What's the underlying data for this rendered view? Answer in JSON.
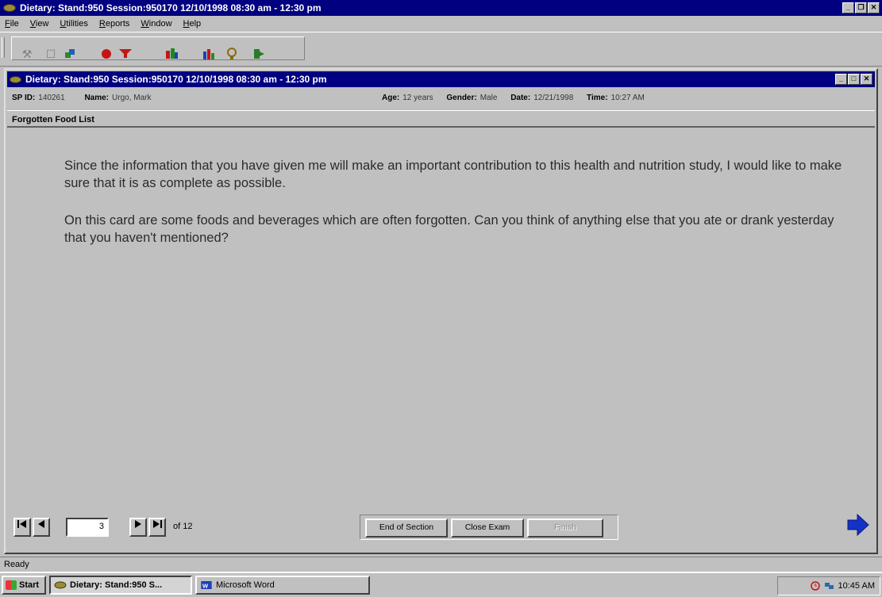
{
  "window": {
    "title": "Dietary: Stand:950 Session:950170 12/10/1998 08:30 am - 12:30 pm"
  },
  "menu": [
    "File",
    "View",
    "Utilities",
    "Reports",
    "Window",
    "Help"
  ],
  "toolbar": {
    "icons": [
      "tool-icon",
      "new-document-icon",
      "flag-icon",
      "record-icon",
      "funnel-icon",
      "chart-icon",
      "stats-icon",
      "bulb-icon",
      "exit-icon"
    ]
  },
  "child_window": {
    "title": "Dietary: Stand:950 Session:950170 12/10/1998 08:30 am - 12:30 pm"
  },
  "info": {
    "sp_label": "SP ID:",
    "sp_value": "140261",
    "name_label": "Name:",
    "name_value": "Urgo, Mark",
    "age_label": "Age:",
    "age_value": "12 years",
    "gender_label": "Gender:",
    "gender_value": "Male",
    "date_label": "Date:",
    "date_value": "12/21/1998",
    "time_label": "Time:",
    "time_value": "10:27 AM"
  },
  "section": {
    "title": "Forgotten Food List"
  },
  "content": {
    "para1": "Since the information that you have given me will make an important contribution to this health and nutrition study, I would like to make sure that it is as complete as possible.",
    "para2": "On this card are some foods and beverages which are often forgotten. Can you think of anything else that you ate or drank yesterday that you haven't mentioned?"
  },
  "navigation": {
    "current_page": "3",
    "of_label": "of 12",
    "end_section": "End of Section",
    "close_exam": "Close Exam",
    "finish": "Finish"
  },
  "status": {
    "text": "Ready"
  },
  "taskbar": {
    "start": "Start",
    "task1": "Dietary: Stand:950 S...",
    "task2": "Microsoft Word",
    "clock": "10:45 AM"
  }
}
